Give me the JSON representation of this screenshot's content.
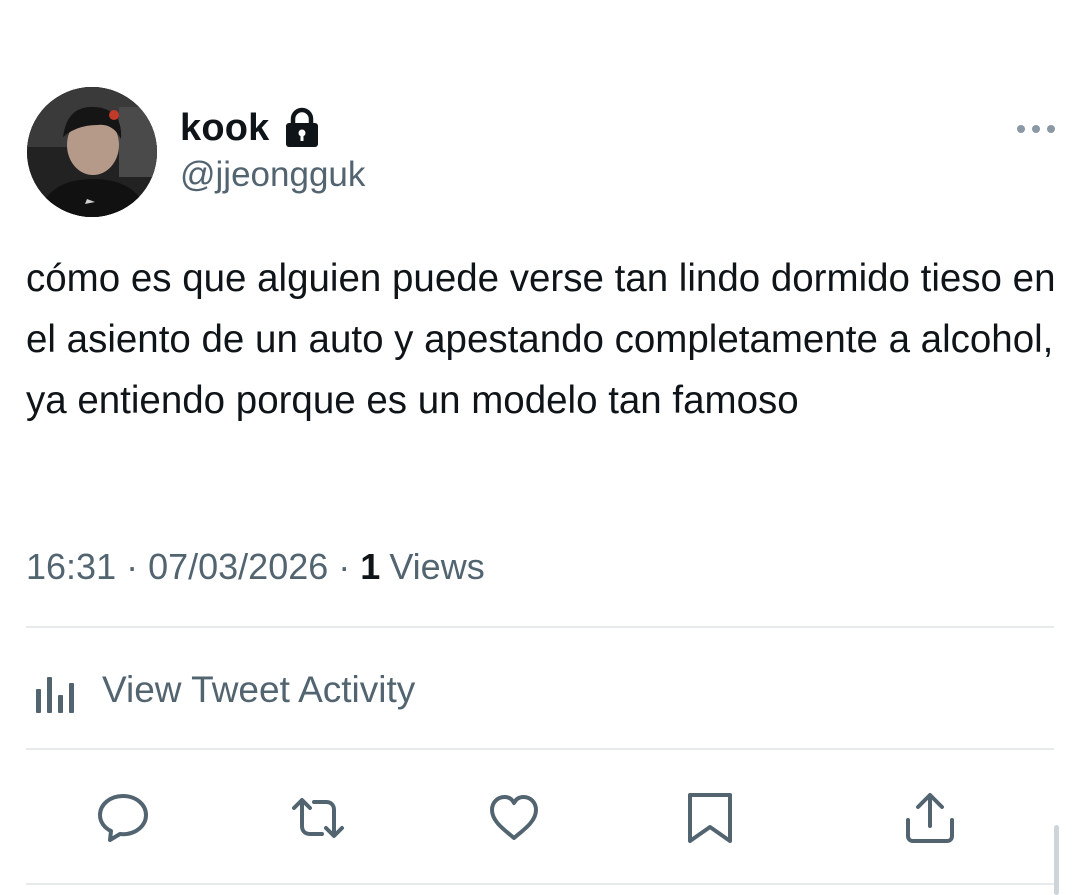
{
  "tweet": {
    "author": {
      "display_name": "kook",
      "handle": "@jjeongguk",
      "protected_icon": "lock-icon",
      "avatar": "profile-photo"
    },
    "text": "cómo es que alguien puede verse tan lindo dormido tieso en el asiento de un auto y apestando completamente a alcohol, ya entiendo porque es un modelo tan famoso",
    "time": "16:31",
    "date": "07/03/2026",
    "separator": "·",
    "views_count": "1",
    "views_label": "Views"
  },
  "activity": {
    "label": "View Tweet Activity",
    "icon": "analytics-bars-icon"
  },
  "actions": [
    {
      "name": "reply",
      "icon": "speech-bubble-icon"
    },
    {
      "name": "retweet",
      "icon": "retweet-arrows-icon"
    },
    {
      "name": "like",
      "icon": "heart-icon"
    },
    {
      "name": "bookmark",
      "icon": "bookmark-icon"
    },
    {
      "name": "share",
      "icon": "share-upload-icon"
    }
  ],
  "colors": {
    "text_primary": "#0f1419",
    "text_secondary": "#536471",
    "divider": "#e7eaec",
    "background": "#ffffff"
  }
}
